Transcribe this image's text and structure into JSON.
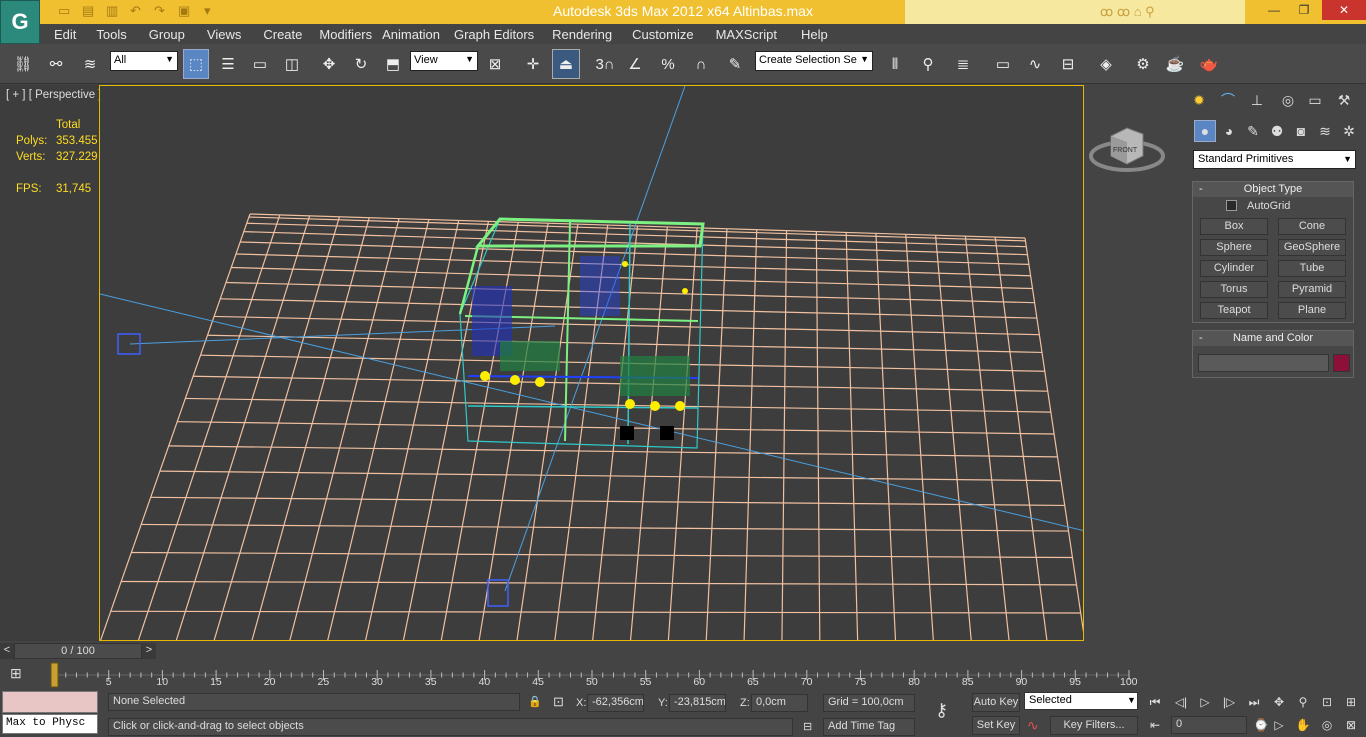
{
  "window": {
    "title": "Autodesk 3ds Max  2012 x64      Altinbas.max",
    "minimize": "—",
    "restore": "❐",
    "close": "✕"
  },
  "menubar": [
    "Edit",
    "Tools",
    "Group",
    "Views",
    "Create",
    "Modifiers",
    "Animation",
    "Graph Editors",
    "Rendering",
    "Customize",
    "MAXScript",
    "Help"
  ],
  "toolbar": {
    "selection_filter": "All",
    "ref_coord": "View",
    "named_selection": "Create Selection Se",
    "snap_angle": "3",
    "snap_percent": "%",
    "snap_spinner": "%"
  },
  "viewport": {
    "label": "[ + ] [ Perspective ] [ Wireframe ]",
    "stats": {
      "header": "Total",
      "polys_label": "Polys:",
      "polys_value": "353.455",
      "verts_label": "Verts:",
      "verts_value": "327.229",
      "fps_label": "FPS:",
      "fps_value": "31,745"
    },
    "viewcube_face": "FRONT"
  },
  "command_panel": {
    "dropdown": "Standard Primitives",
    "object_type": {
      "title": "Object Type",
      "autogrid": "AutoGrid",
      "buttons": [
        "Box",
        "Cone",
        "Sphere",
        "GeoSphere",
        "Cylinder",
        "Tube",
        "Torus",
        "Pyramid",
        "Teapot",
        "Plane"
      ]
    },
    "name_color": {
      "title": "Name and Color",
      "color": "#8c1038"
    }
  },
  "timeline": {
    "frame": "0 / 100",
    "prev": "<",
    "next": ">",
    "ticks": [
      "0",
      "5",
      "10",
      "15",
      "20",
      "25",
      "30",
      "35",
      "40",
      "45",
      "50",
      "55",
      "60",
      "65",
      "70",
      "75",
      "80",
      "85",
      "90",
      "95",
      "100"
    ]
  },
  "status": {
    "listener": "Max to Physc",
    "selection": "None Selected",
    "prompt": "Click or click-and-drag to select objects",
    "x_label": "X:",
    "x": "-62,356cm",
    "y_label": "Y:",
    "y": "-23,815cm",
    "z_label": "Z:",
    "z": "0,0cm",
    "grid": "Grid = 100,0cm",
    "add_time_tag": "Add Time Tag",
    "auto_key": "Auto Key",
    "set_key": "Set Key",
    "key_mode": "Selected",
    "key_filters": "Key Filters...",
    "current_frame": "0"
  }
}
